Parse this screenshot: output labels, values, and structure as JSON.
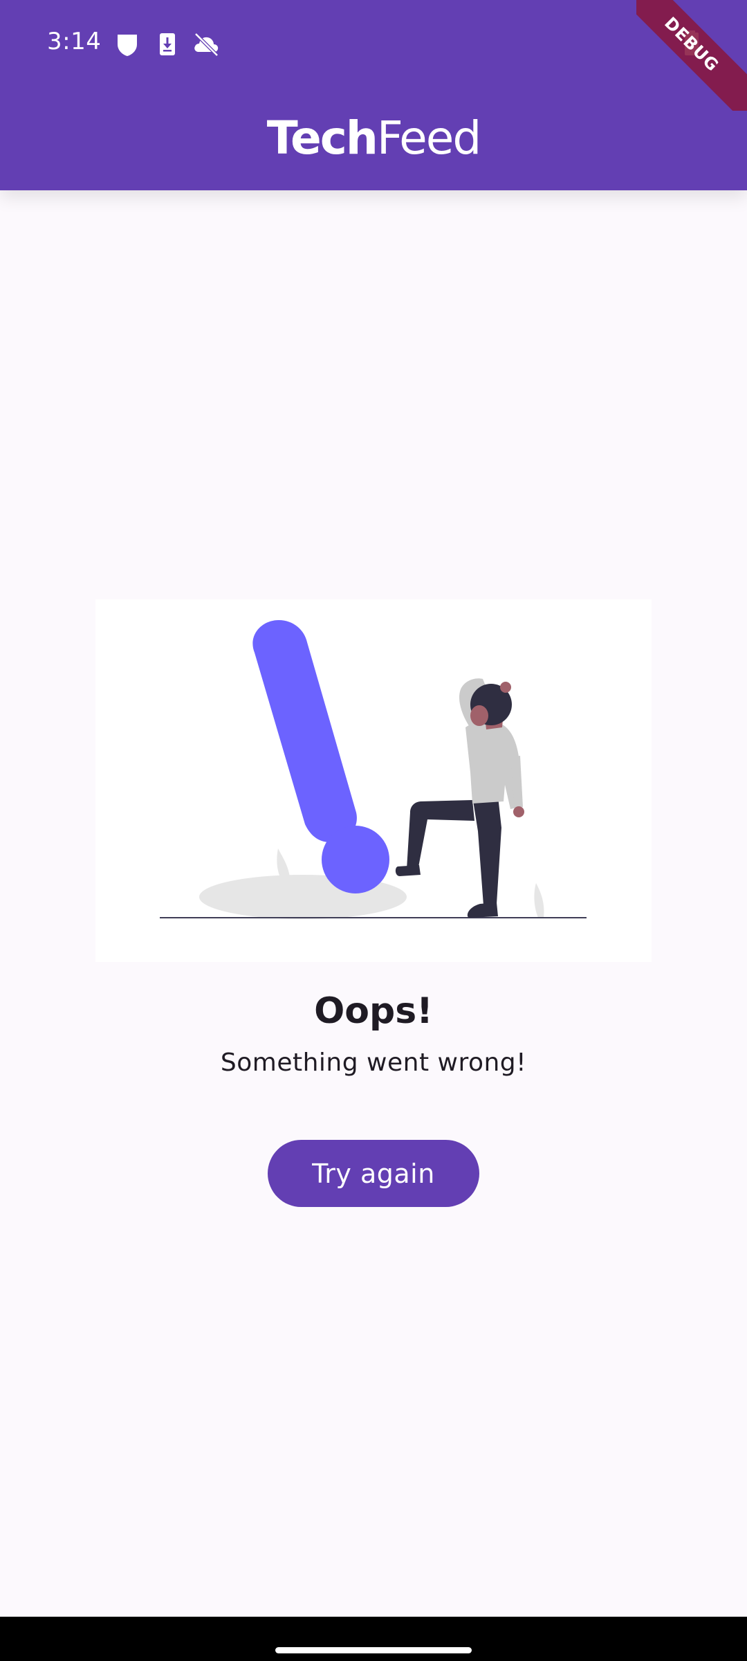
{
  "status_bar": {
    "time": "3:14",
    "icons": [
      "shield-icon",
      "download-icon",
      "cloud-off-icon",
      "battery-charging-icon"
    ]
  },
  "app_bar": {
    "title_bold": "Tech",
    "title_light": "Feed"
  },
  "debug_banner": {
    "label": "DEBUG"
  },
  "error_state": {
    "illustration": "person-with-exclamation-mark-illustration",
    "title": "Oops!",
    "message": "Something went wrong!",
    "retry_label": "Try again"
  },
  "colors": {
    "primary": "#633fb3",
    "background": "#fcf9fd",
    "accent_illustration": "#6c63ff",
    "text_primary": "#1f1b24",
    "debug_ribbon": "#881840"
  }
}
